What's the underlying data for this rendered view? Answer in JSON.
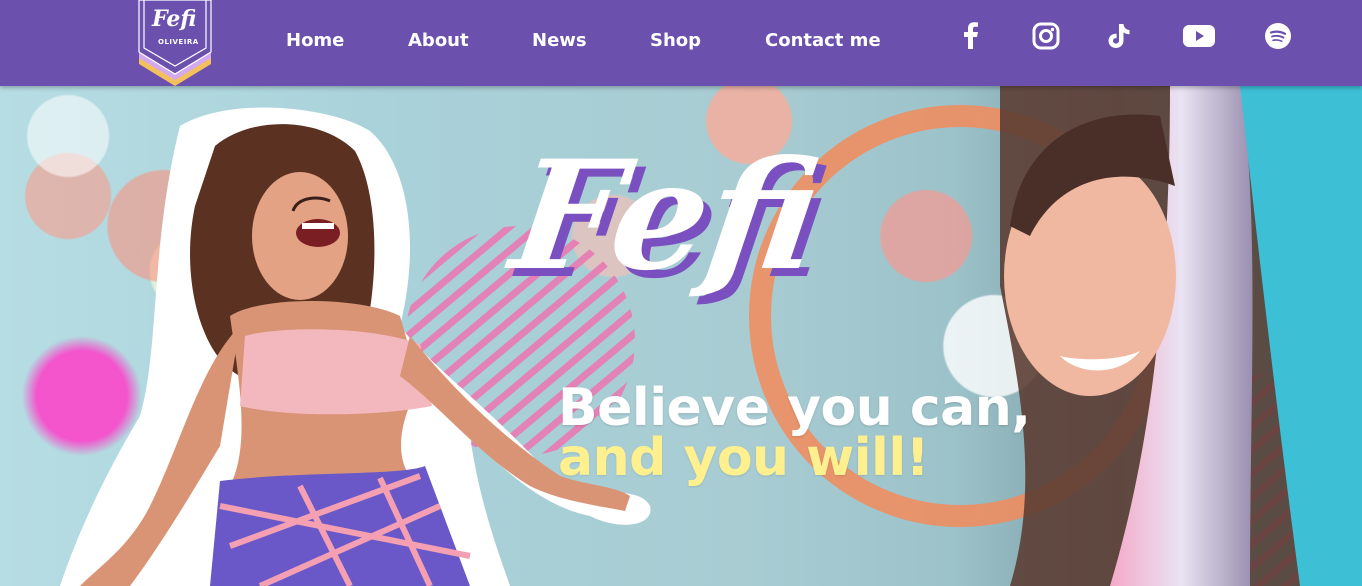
{
  "brand": {
    "logo_text": "Fefi",
    "logo_sub": "OLIVEIRA"
  },
  "nav": {
    "items": [
      {
        "label": "Home"
      },
      {
        "label": "About"
      },
      {
        "label": "News"
      },
      {
        "label": "Shop"
      },
      {
        "label": "Contact me"
      }
    ]
  },
  "social": {
    "items": [
      {
        "icon": "facebook-icon"
      },
      {
        "icon": "instagram-icon"
      },
      {
        "icon": "tiktok-icon"
      },
      {
        "icon": "youtube-icon"
      },
      {
        "icon": "spotify-icon"
      }
    ]
  },
  "hero": {
    "title": "Fefi",
    "slogan_line1": "Believe you can,",
    "slogan_line2": "and you will!"
  },
  "colors": {
    "nav_bg": "#6b50ad",
    "title_white": "#ffffff",
    "title_shadow": "#7a4fbf",
    "slogan_line2": "#fff08f",
    "stripe_pink": "#e879b2"
  }
}
